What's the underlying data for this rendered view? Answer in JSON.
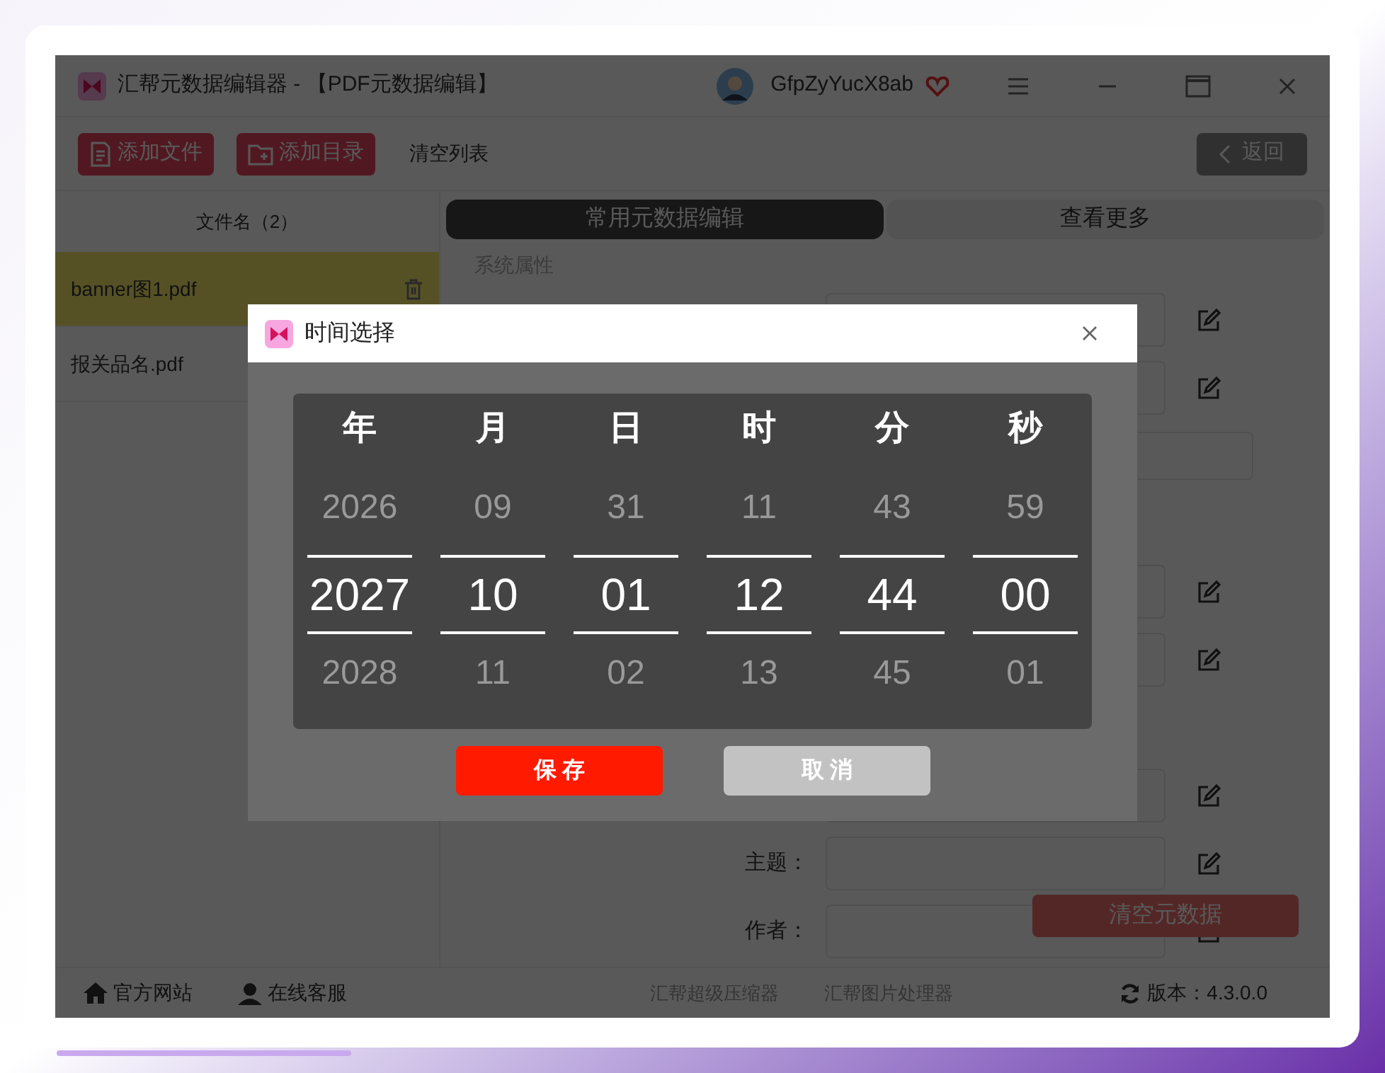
{
  "window": {
    "title": "汇帮元数据编辑器 - 【PDF元数据编辑】",
    "username": "GfpZyYucX8ab"
  },
  "toolbar": {
    "buttons": [
      {
        "label": "添加文件",
        "kind": "file"
      },
      {
        "label": "添加目录",
        "kind": "folder"
      }
    ],
    "clear_list": "清空列表",
    "back": "返回"
  },
  "file_list": {
    "header": "文件名（2）",
    "items": [
      {
        "name": "banner图1.pdf",
        "selected": true
      },
      {
        "name": "报关品名.pdf",
        "selected": false
      }
    ]
  },
  "tabs": [
    {
      "label": "常用元数据编辑",
      "selected": true
    },
    {
      "label": "查看更多",
      "selected": false
    }
  ],
  "section_title": "系统属性",
  "form_rows": [
    {
      "kind": "field"
    },
    {
      "kind": "field"
    },
    {
      "kind": "wide"
    },
    {
      "kind": "field",
      "gap_before": true
    },
    {
      "kind": "field"
    },
    {
      "kind": "field",
      "gap_before": true
    },
    {
      "kind": "field",
      "label": "主题："
    },
    {
      "kind": "field",
      "label": "作者："
    }
  ],
  "clear_metadata": "清空元数据",
  "footer": {
    "links": [
      {
        "label": "官方网站",
        "kind": "home"
      },
      {
        "label": "在线客服",
        "kind": "support"
      }
    ],
    "products": [
      "汇帮超级压缩器",
      "汇帮图片处理器"
    ],
    "version": "版本：4.3.0.0"
  },
  "dialog": {
    "title": "时间选择",
    "columns": [
      {
        "header": "年",
        "prev": "2026",
        "value": "2027",
        "next": "2028"
      },
      {
        "header": "月",
        "prev": "09",
        "value": "10",
        "next": "11"
      },
      {
        "header": "日",
        "prev": "31",
        "value": "01",
        "next": "02"
      },
      {
        "header": "时",
        "prev": "11",
        "value": "12",
        "next": "13"
      },
      {
        "header": "分",
        "prev": "43",
        "value": "44",
        "next": "45"
      },
      {
        "header": "秒",
        "prev": "59",
        "value": "00",
        "next": "01"
      }
    ],
    "save": "保 存",
    "cancel": "取 消"
  }
}
